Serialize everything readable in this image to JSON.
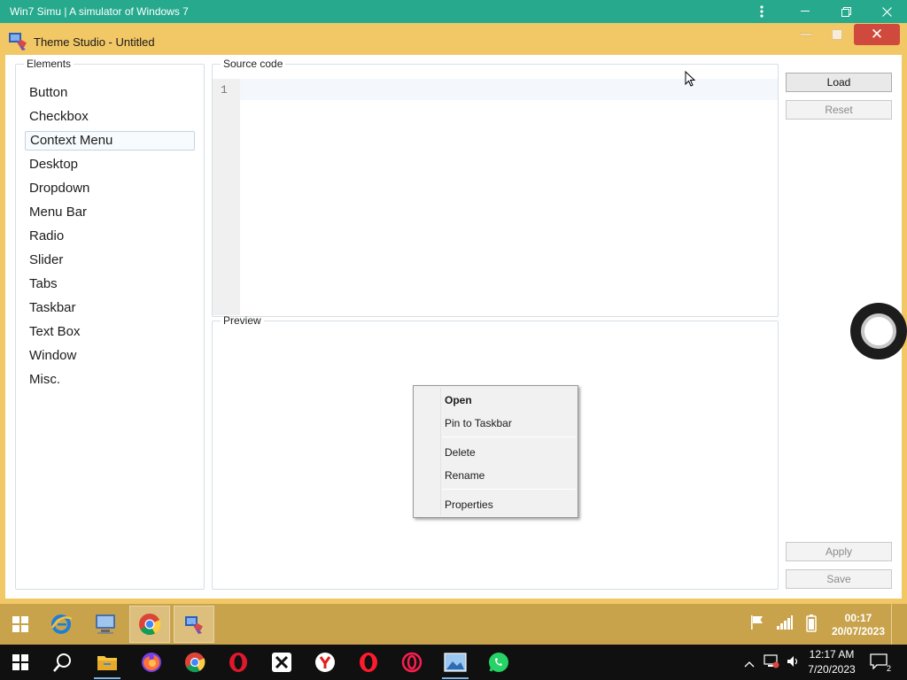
{
  "host": {
    "title": "Win7 Simu | A simulator of Windows 7",
    "menu_icon": "more-vertical-icon",
    "minimize_icon": "minimize-icon",
    "restore_icon": "restore-icon",
    "close_icon": "close-icon"
  },
  "window": {
    "title": "Theme Studio - Untitled",
    "icon": "theme-studio-icon",
    "close_glyph": "✕"
  },
  "elements_panel": {
    "legend": "Elements",
    "items": [
      {
        "label": "Button"
      },
      {
        "label": "Checkbox"
      },
      {
        "label": "Context Menu",
        "selected": true
      },
      {
        "label": "Desktop"
      },
      {
        "label": "Dropdown"
      },
      {
        "label": "Menu Bar"
      },
      {
        "label": "Radio"
      },
      {
        "label": "Slider"
      },
      {
        "label": "Tabs"
      },
      {
        "label": "Taskbar"
      },
      {
        "label": "Text Box"
      },
      {
        "label": "Window"
      },
      {
        "label": "Misc."
      }
    ]
  },
  "source_panel": {
    "legend": "Source code",
    "line_numbers": [
      "1"
    ]
  },
  "preview_panel": {
    "legend": "Preview",
    "context_menu": {
      "items": [
        "Open",
        "Pin to Taskbar",
        "Delete",
        "Rename",
        "Properties"
      ],
      "default_item": "Open"
    }
  },
  "buttons": {
    "load": "Load",
    "reset": "Reset",
    "apply": "Apply",
    "save": "Save"
  },
  "sim_taskbar": {
    "time": "00:17",
    "date": "20/07/2023",
    "pinned": [
      "start-orb-icon",
      "internet-explorer-icon",
      "computer-icon",
      "chrome-icon",
      "theme-studio-icon"
    ]
  },
  "os_taskbar": {
    "time": "12:17 AM",
    "date": "7/20/2023",
    "notification_count": "2",
    "apps": [
      "start-icon",
      "search-icon",
      "file-explorer-icon",
      "firefox-icon",
      "chrome-icon",
      "opera-icon",
      "capcut-icon",
      "yandex-icon",
      "opera-red-icon",
      "opera-gx-icon",
      "photos-icon",
      "whatsapp-icon"
    ]
  },
  "colors": {
    "host_accent": "#26a98d",
    "window_frame": "#f2c766",
    "sim_taskbar": "#c9a34b",
    "close_button": "#cf4a3c"
  }
}
